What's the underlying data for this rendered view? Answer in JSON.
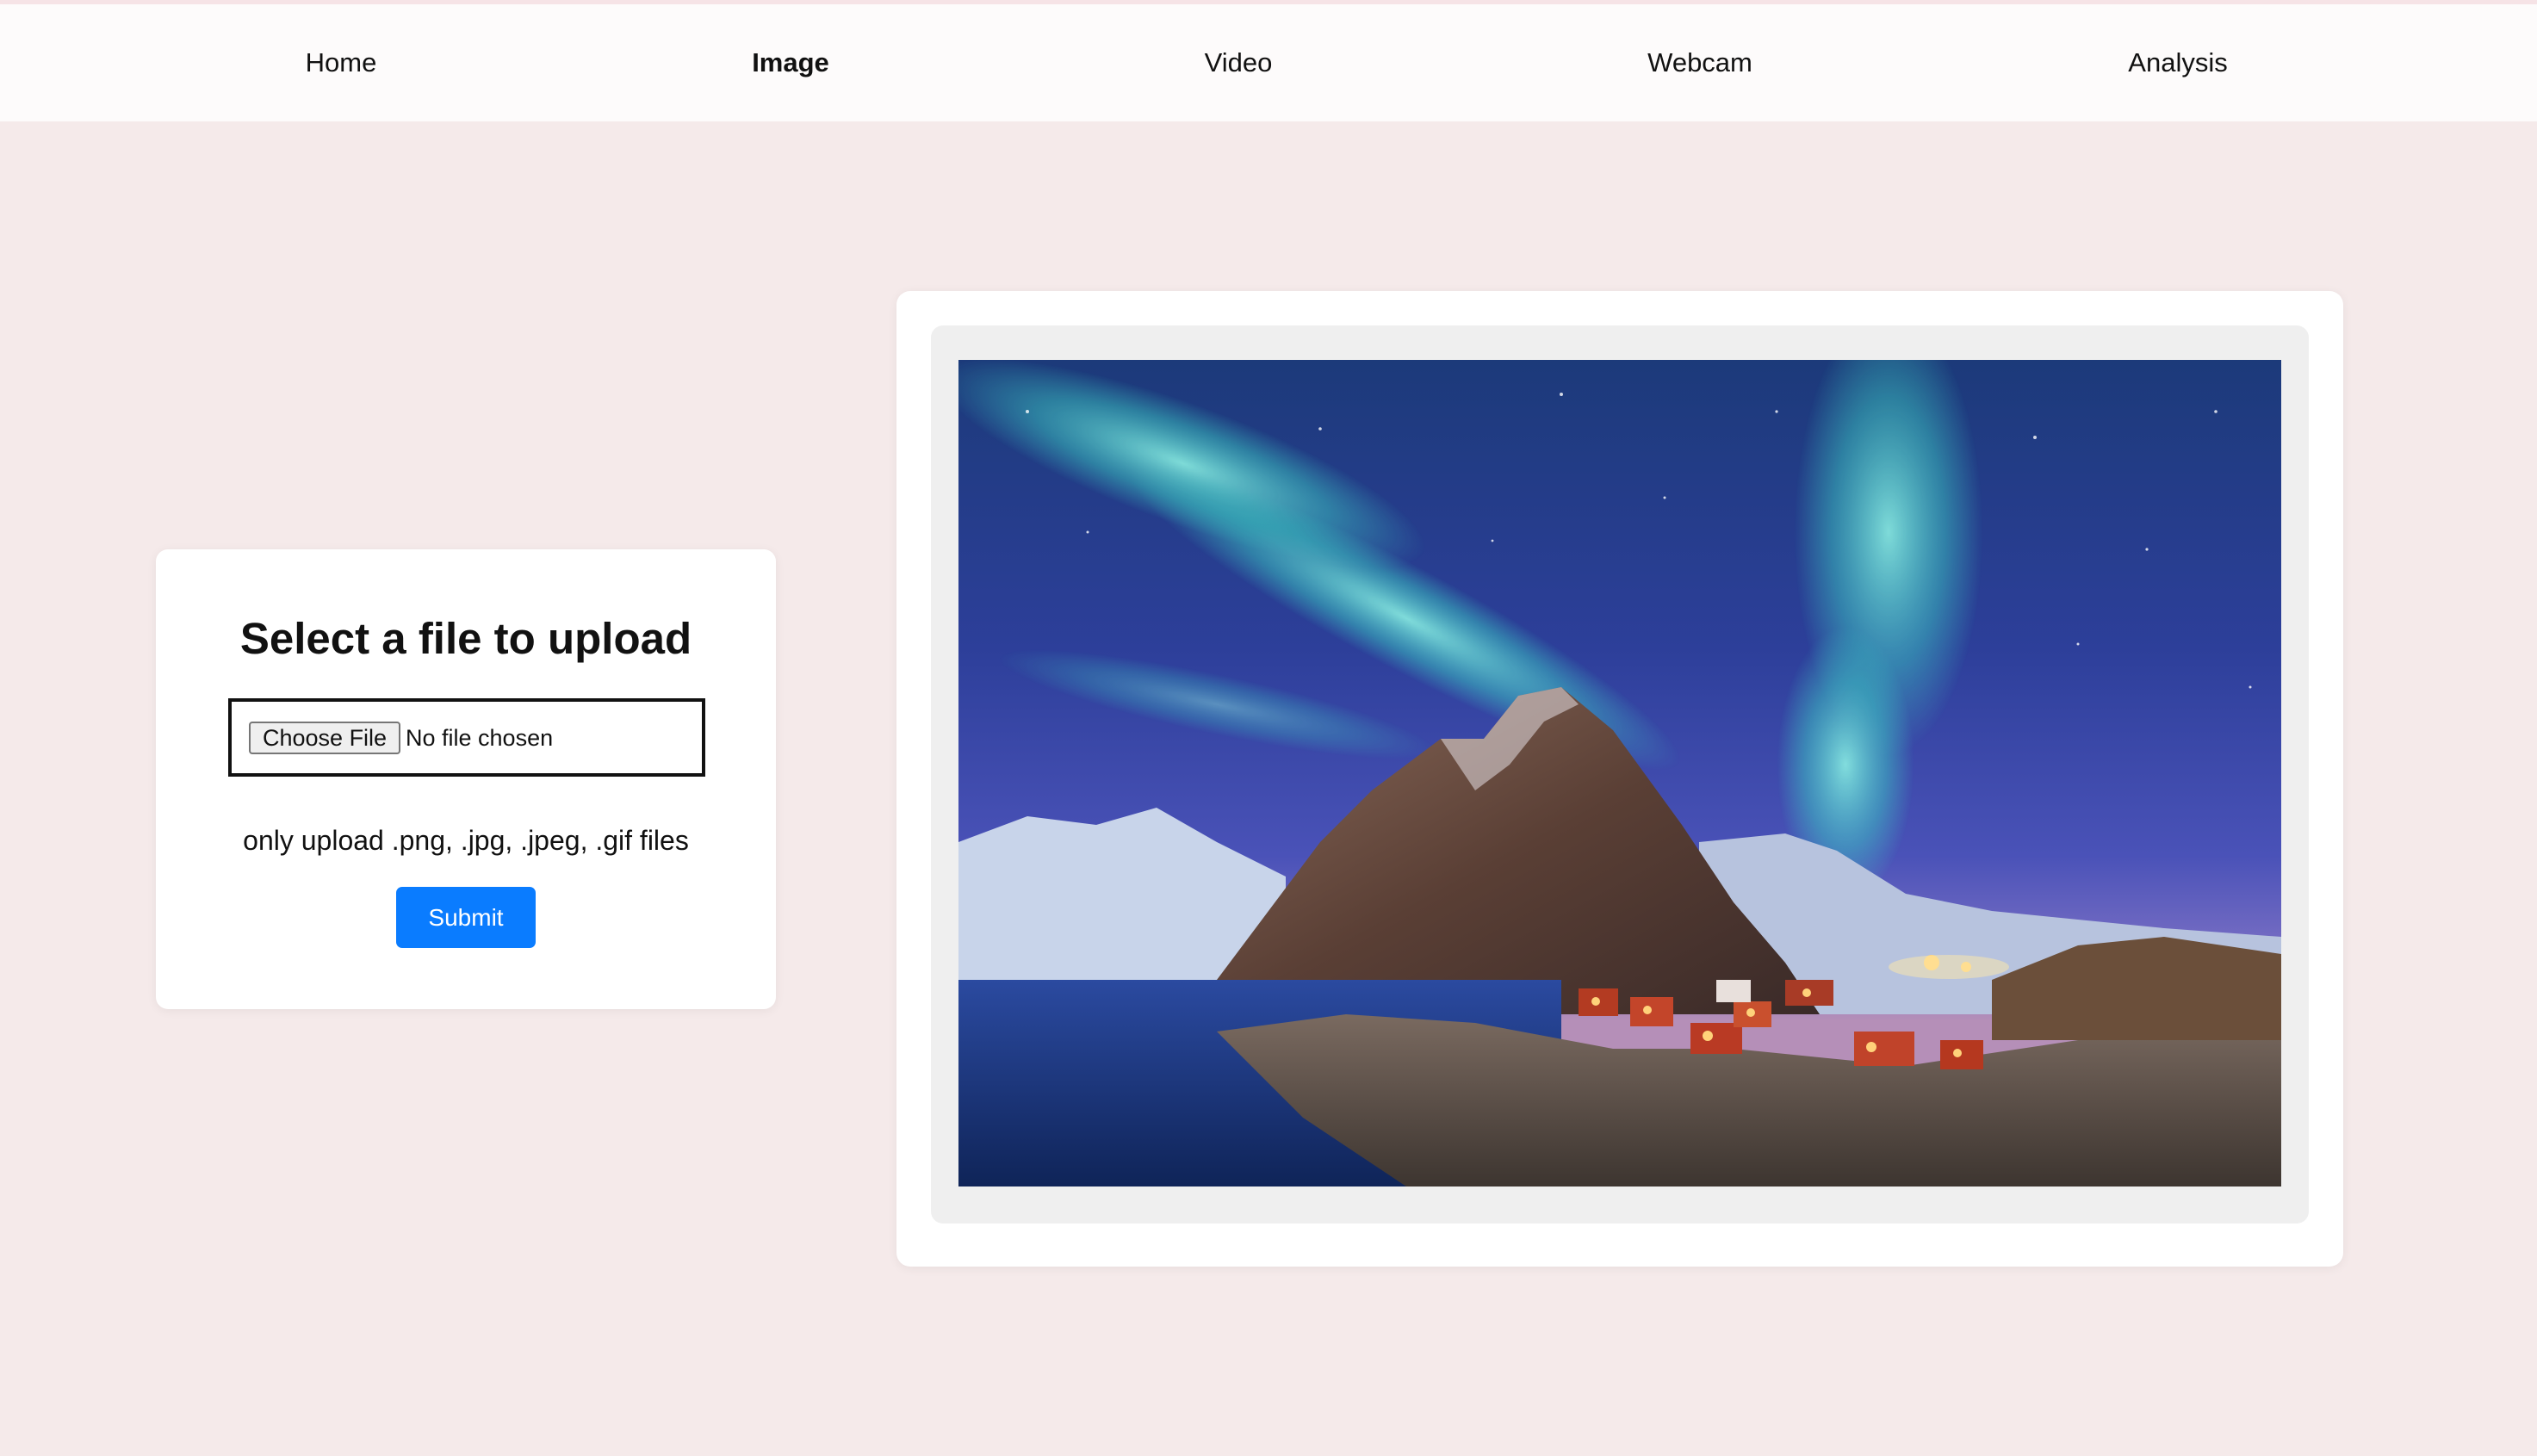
{
  "nav": {
    "items": [
      {
        "label": "Home",
        "active": false
      },
      {
        "label": "Image",
        "active": true
      },
      {
        "label": "Video",
        "active": false
      },
      {
        "label": "Webcam",
        "active": false
      },
      {
        "label": "Analysis",
        "active": false
      }
    ]
  },
  "upload": {
    "title": "Select a file to upload",
    "choose_file_label": "Choose File",
    "file_status": "No file chosen",
    "hint": "only upload .png, .jpg, .jpeg, .gif files",
    "submit_label": "Submit"
  },
  "preview": {
    "image_description": "aurora-over-mountain-village-photo"
  },
  "colors": {
    "page_background": "#f5eaea",
    "navbar_background": "#fdfbfb",
    "accent": "#0a7cff",
    "card_background": "#ffffff",
    "preview_frame": "#efefef"
  }
}
